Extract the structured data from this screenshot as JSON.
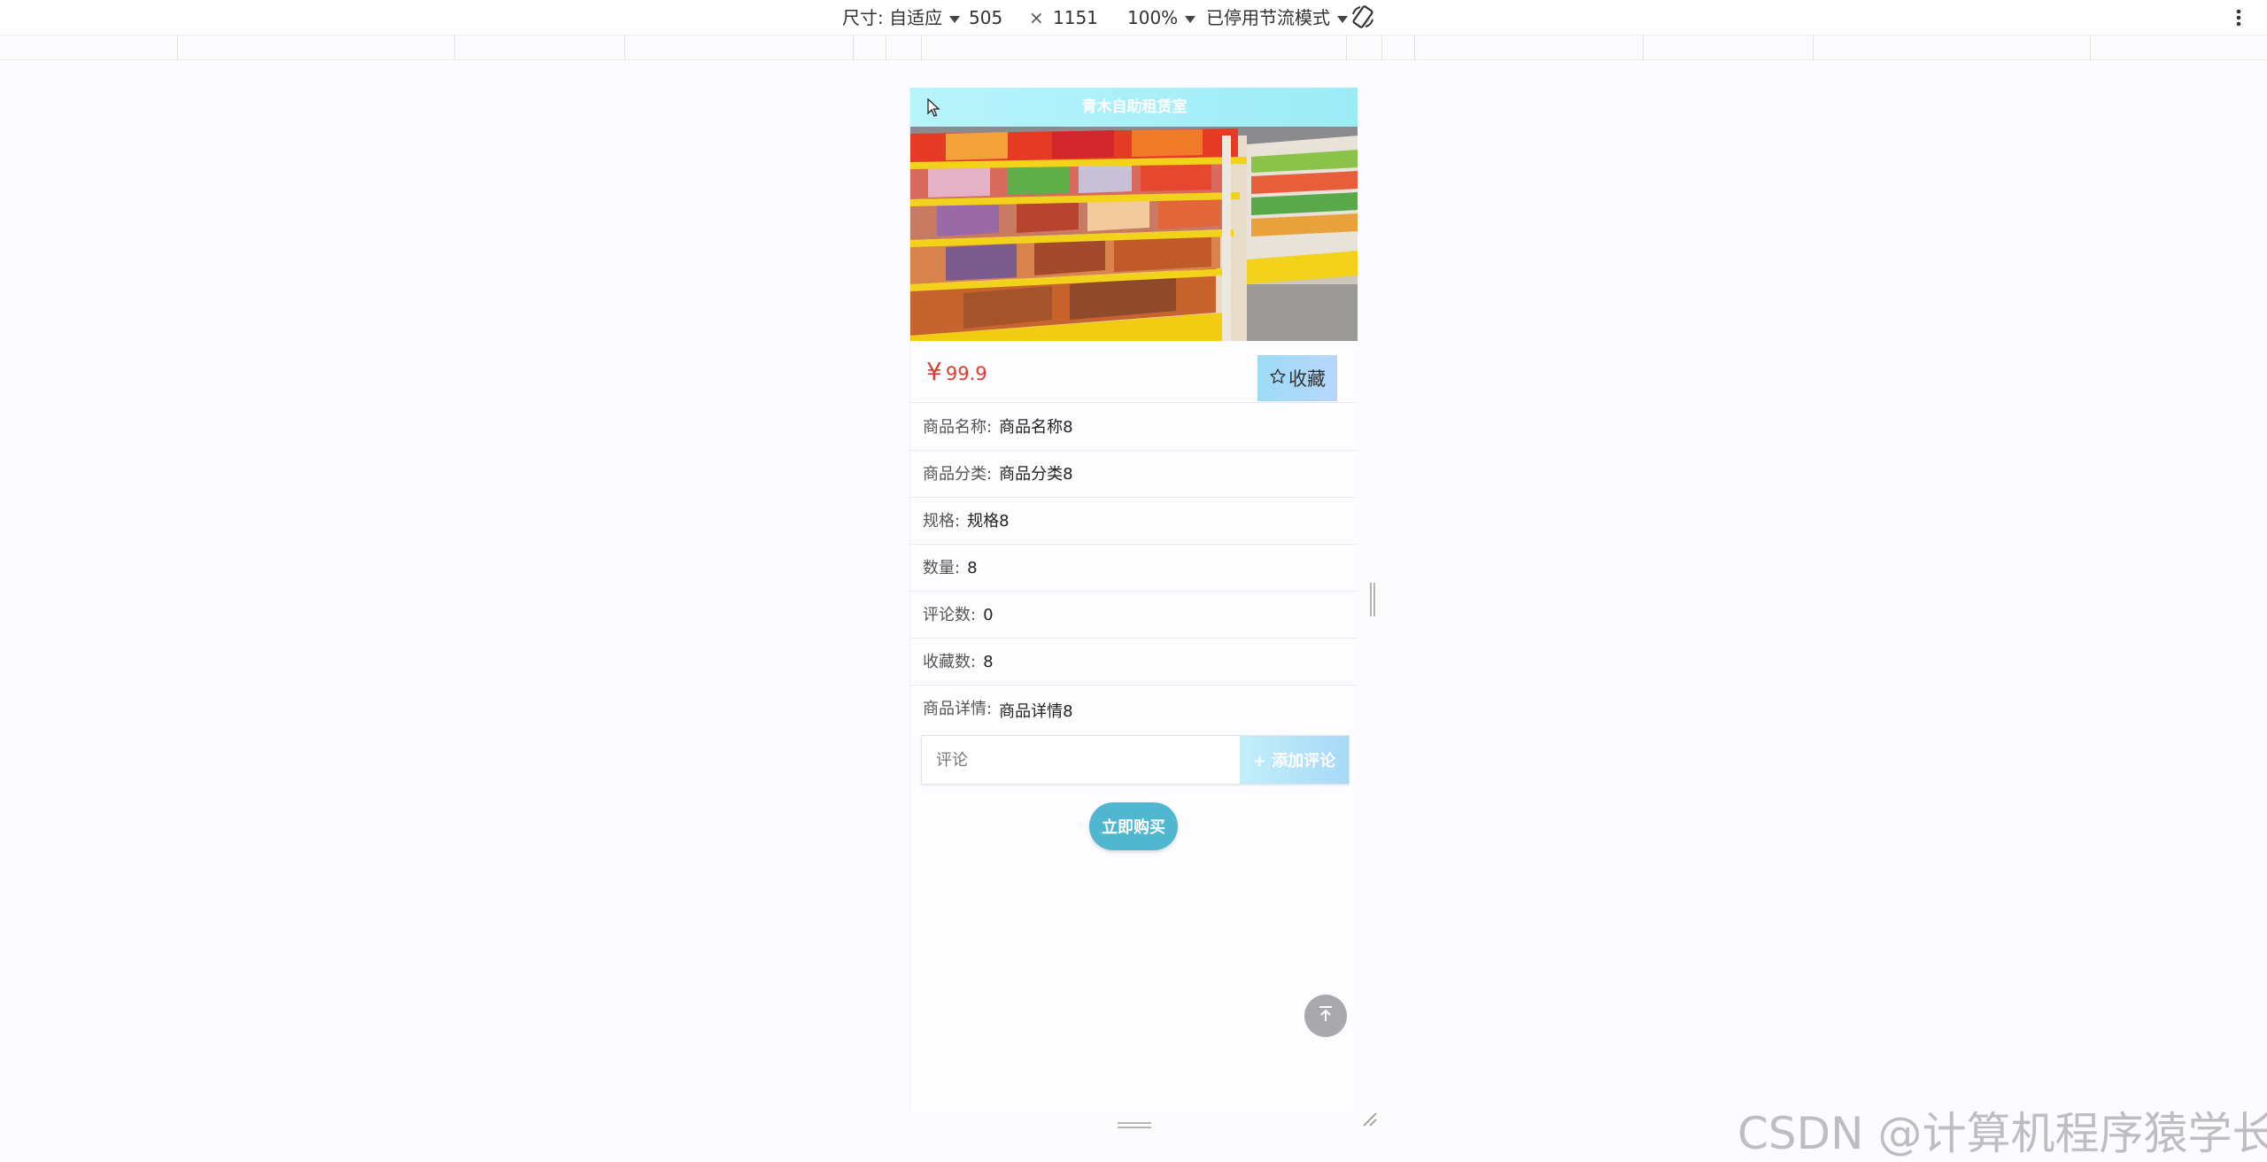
{
  "devtools": {
    "size_label": "尺寸: 自适应",
    "width": "505",
    "times": "×",
    "height": "1151",
    "zoom": "100%",
    "throttle": "已停用节流模式",
    "rotate_icon": "rotate-icon",
    "more_icon": "more-vertical-icon"
  },
  "page": {
    "header_title": "青木自助租赁室",
    "price_symbol": "¥",
    "price": "99.9",
    "favorite_label": "收藏",
    "details": [
      {
        "label": "商品名称:",
        "value": "商品名称8"
      },
      {
        "label": "商品分类:",
        "value": "商品分类8"
      },
      {
        "label": "规格:",
        "value": "规格8"
      },
      {
        "label": "数量:",
        "value": "8"
      },
      {
        "label": "评论数:",
        "value": "0"
      },
      {
        "label": "收藏数:",
        "value": "8"
      },
      {
        "label": "商品详情:",
        "value": "商品详情8"
      }
    ],
    "comment_placeholder": "评论",
    "add_comment_label": "+ 添加评论",
    "buy_label": "立即购买"
  },
  "watermark": "CSDN @计算机程序猿学长",
  "colors": {
    "header": "#a8eff9",
    "price": "#e23b2e",
    "buy_button": "#4fb8d0",
    "favorite_button": "#a9d9f7"
  }
}
